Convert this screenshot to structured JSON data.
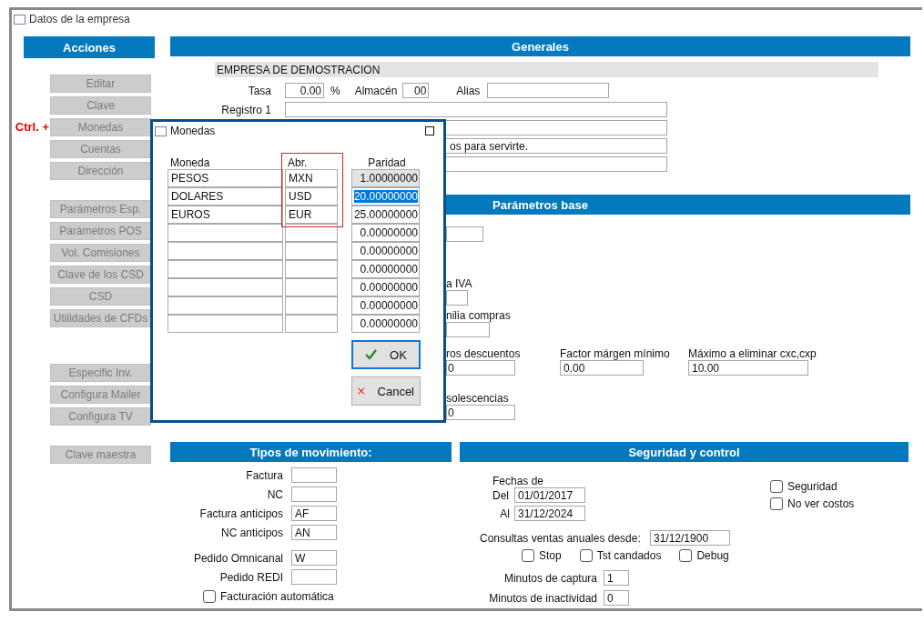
{
  "window": {
    "title": "Datos de la empresa"
  },
  "actions": {
    "title": "Acciones",
    "groups": [
      [
        {
          "label": "Editar",
          "disabled": true
        },
        {
          "label": "Clave",
          "disabled": true
        },
        {
          "label": "Monedas",
          "disabled": true,
          "annotation": "Ctrl. +"
        },
        {
          "label": "Cuentas",
          "disabled": true
        },
        {
          "label": "Dirección",
          "disabled": true
        }
      ],
      [
        {
          "label": "Parámetros Esp.",
          "disabled": true
        },
        {
          "label": "Parámetros POS",
          "disabled": true
        },
        {
          "label": "Vol. Comisiones",
          "disabled": true
        },
        {
          "label": "Clave de los CSD",
          "disabled": true
        },
        {
          "label": "CSD",
          "disabled": true
        },
        {
          "label": "Utilidades de CFDs",
          "disabled": true
        }
      ],
      [
        {
          "label": "Especific Inv.",
          "disabled": true
        },
        {
          "label": "Configura Mailer",
          "disabled": true
        },
        {
          "label": "Configura TV",
          "disabled": true
        }
      ],
      [
        {
          "label": "Clave maestra",
          "disabled": true
        }
      ]
    ]
  },
  "generales": {
    "title": "Generales",
    "company_name": "EMPRESA DE DEMOSTRACION",
    "tasa": {
      "label": "Tasa",
      "value": "0.00",
      "unit": "%"
    },
    "almacen": {
      "label": "Almacén",
      "value": "00"
    },
    "alias": {
      "label": "Alias"
    },
    "registro": {
      "label": "Registro 1"
    },
    "note_line": {
      "value": "os para servirte."
    }
  },
  "parametros_base": {
    "title": "Parámetros base",
    "iva": {
      "label": "a IVA"
    },
    "familia": {
      "label": "nilia compras"
    },
    "row": [
      {
        "label": "ros descuentos",
        "value": "0"
      },
      {
        "label": "Factor márgen mínimo",
        "value": "0.00"
      },
      {
        "label": "Máximo a eliminar cxc,cxp",
        "value": "10.00"
      }
    ],
    "obsolescencias": {
      "label": "solescencias",
      "value": "0"
    }
  },
  "tipos": {
    "title": "Tipos de movimiento:",
    "groups": [
      [
        {
          "label": "Factura"
        },
        {
          "label": "NC"
        },
        {
          "label": "Factura anticipos",
          "value": "AF"
        },
        {
          "label": "NC anticipos",
          "value": "AN"
        }
      ],
      [
        {
          "label": "Pedido Omnicanal",
          "value": "W"
        },
        {
          "label": "Pedido REDI"
        }
      ]
    ],
    "auto_invoice": {
      "label": "Facturación automática",
      "checked": false
    }
  },
  "seguridad": {
    "title": "Seguridad y control",
    "fechas_label": "Fechas de",
    "del": {
      "label": "Del",
      "value": "01/01/2017"
    },
    "al": {
      "label": "Al",
      "value": "31/12/2024"
    },
    "side_checks": [
      {
        "label": "Seguridad",
        "checked": false
      },
      {
        "label": "No ver costos",
        "checked": false
      }
    ],
    "consultas": {
      "label": "Consultas ventas anuales desde:",
      "value": "31/12/1900"
    },
    "checks": [
      {
        "label": "Stop",
        "checked": false
      },
      {
        "label": "Tst candados",
        "checked": false
      },
      {
        "label": "Debug",
        "checked": false
      }
    ],
    "minutos": [
      {
        "label": "Minutos de captura",
        "value": "1"
      },
      {
        "label": "Minutos de inactividad",
        "value": "0"
      }
    ]
  },
  "dialog": {
    "title": "Monedas",
    "columns": [
      "Moneda",
      "Abr.",
      "Paridad"
    ],
    "rows": [
      {
        "moneda": "PESOS",
        "abr": "MXN",
        "paridad": "1.00000000",
        "readonly": true,
        "selected": false
      },
      {
        "moneda": "DOLARES",
        "abr": "USD",
        "paridad": "20.00000000",
        "readonly": false,
        "selected": true
      },
      {
        "moneda": "EUROS",
        "abr": "EUR",
        "paridad": "25.00000000",
        "readonly": false,
        "selected": false
      },
      {
        "paridad": "0.00000000",
        "readonly": false,
        "selected": false
      },
      {
        "paridad": "0.00000000",
        "readonly": false,
        "selected": false
      },
      {
        "paridad": "0.00000000",
        "readonly": false,
        "selected": false
      },
      {
        "paridad": "0.00000000",
        "readonly": false,
        "selected": false
      },
      {
        "paridad": "0.00000000",
        "readonly": false,
        "selected": false
      },
      {
        "paridad": "0.00000000",
        "readonly": false,
        "selected": false
      }
    ],
    "buttons": [
      {
        "kind": "ok",
        "label": "OK",
        "focused": true
      },
      {
        "kind": "cancel",
        "label": "Cancel",
        "focused": false
      }
    ]
  }
}
